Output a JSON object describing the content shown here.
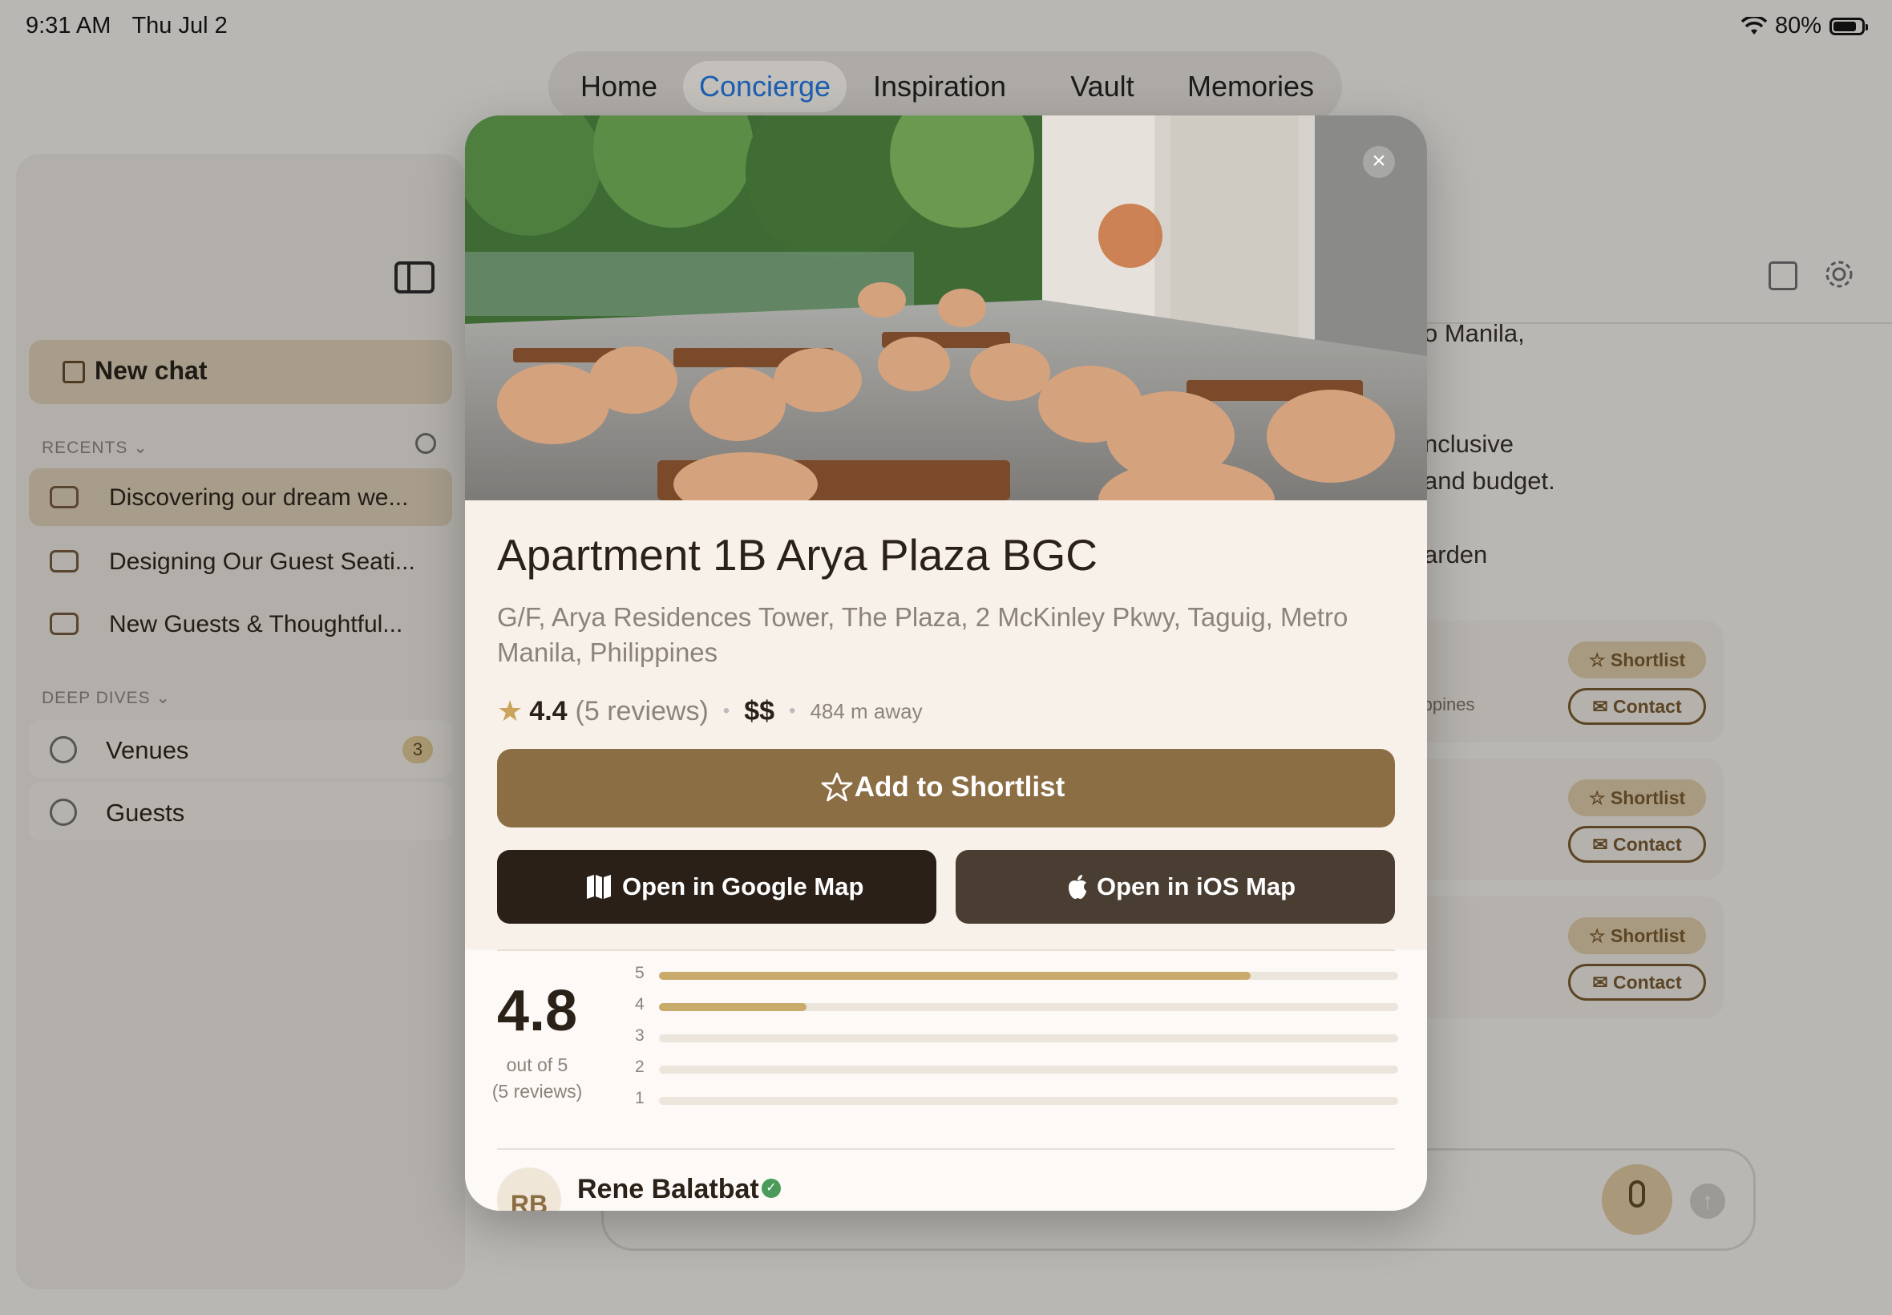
{
  "status_bar": {
    "time": "9:31 AM",
    "date": "Thu Jul 2",
    "battery": "80%"
  },
  "nav": {
    "tabs": [
      "Home",
      "Concierge",
      "Inspiration",
      "Vault",
      "Memories"
    ],
    "active": "Concierge"
  },
  "sidebar": {
    "new_chat": "New chat",
    "recents_label": "RECENTS",
    "recents": [
      "Discovering our dream we...",
      "Designing Our Guest Seati...",
      "New Guests & Thoughtful..."
    ],
    "deep_dives_label": "DEEP DIVES",
    "deep_dives": [
      {
        "label": "Venues",
        "badge": "3"
      },
      {
        "label": "Guests",
        "badge": ""
      }
    ]
  },
  "background_chat": {
    "fragments": [
      "o Manila,",
      "nclusive",
      " and budget.",
      "arden",
      "ilippines"
    ],
    "card_buttons": {
      "shortlist": "Shortlist",
      "contact": "Contact"
    }
  },
  "venue": {
    "title": "Apartment 1B Arya Plaza BGC",
    "address": "G/F, Arya Residences Tower, The Plaza, 2 McKinley Pkwy, Taguig, Metro Manila, Philippines",
    "rating": "4.4",
    "review_count": "(5 reviews)",
    "price": "$$",
    "distance": "484 m away",
    "add_button": "Add to Shortlist",
    "google_map_button": "Open in Google Map",
    "ios_map_button": "Open in iOS Map",
    "close": "×"
  },
  "reviews": {
    "average": "4.8",
    "out_of": "out of 5",
    "count": "(5 reviews)",
    "distribution": [
      {
        "stars": "5",
        "fraction": 0.8
      },
      {
        "stars": "4",
        "fraction": 0.2
      },
      {
        "stars": "3",
        "fraction": 0
      },
      {
        "stars": "2",
        "fraction": 0
      },
      {
        "stars": "1",
        "fraction": 0
      }
    ],
    "first_reviewer": {
      "initials": "RB",
      "name": "Rene Balatbat"
    }
  },
  "colors": {
    "accent_brown": "#8c6e45",
    "active_tab_blue": "#1d5fb0",
    "bar_fill": "#c9ab6c"
  }
}
